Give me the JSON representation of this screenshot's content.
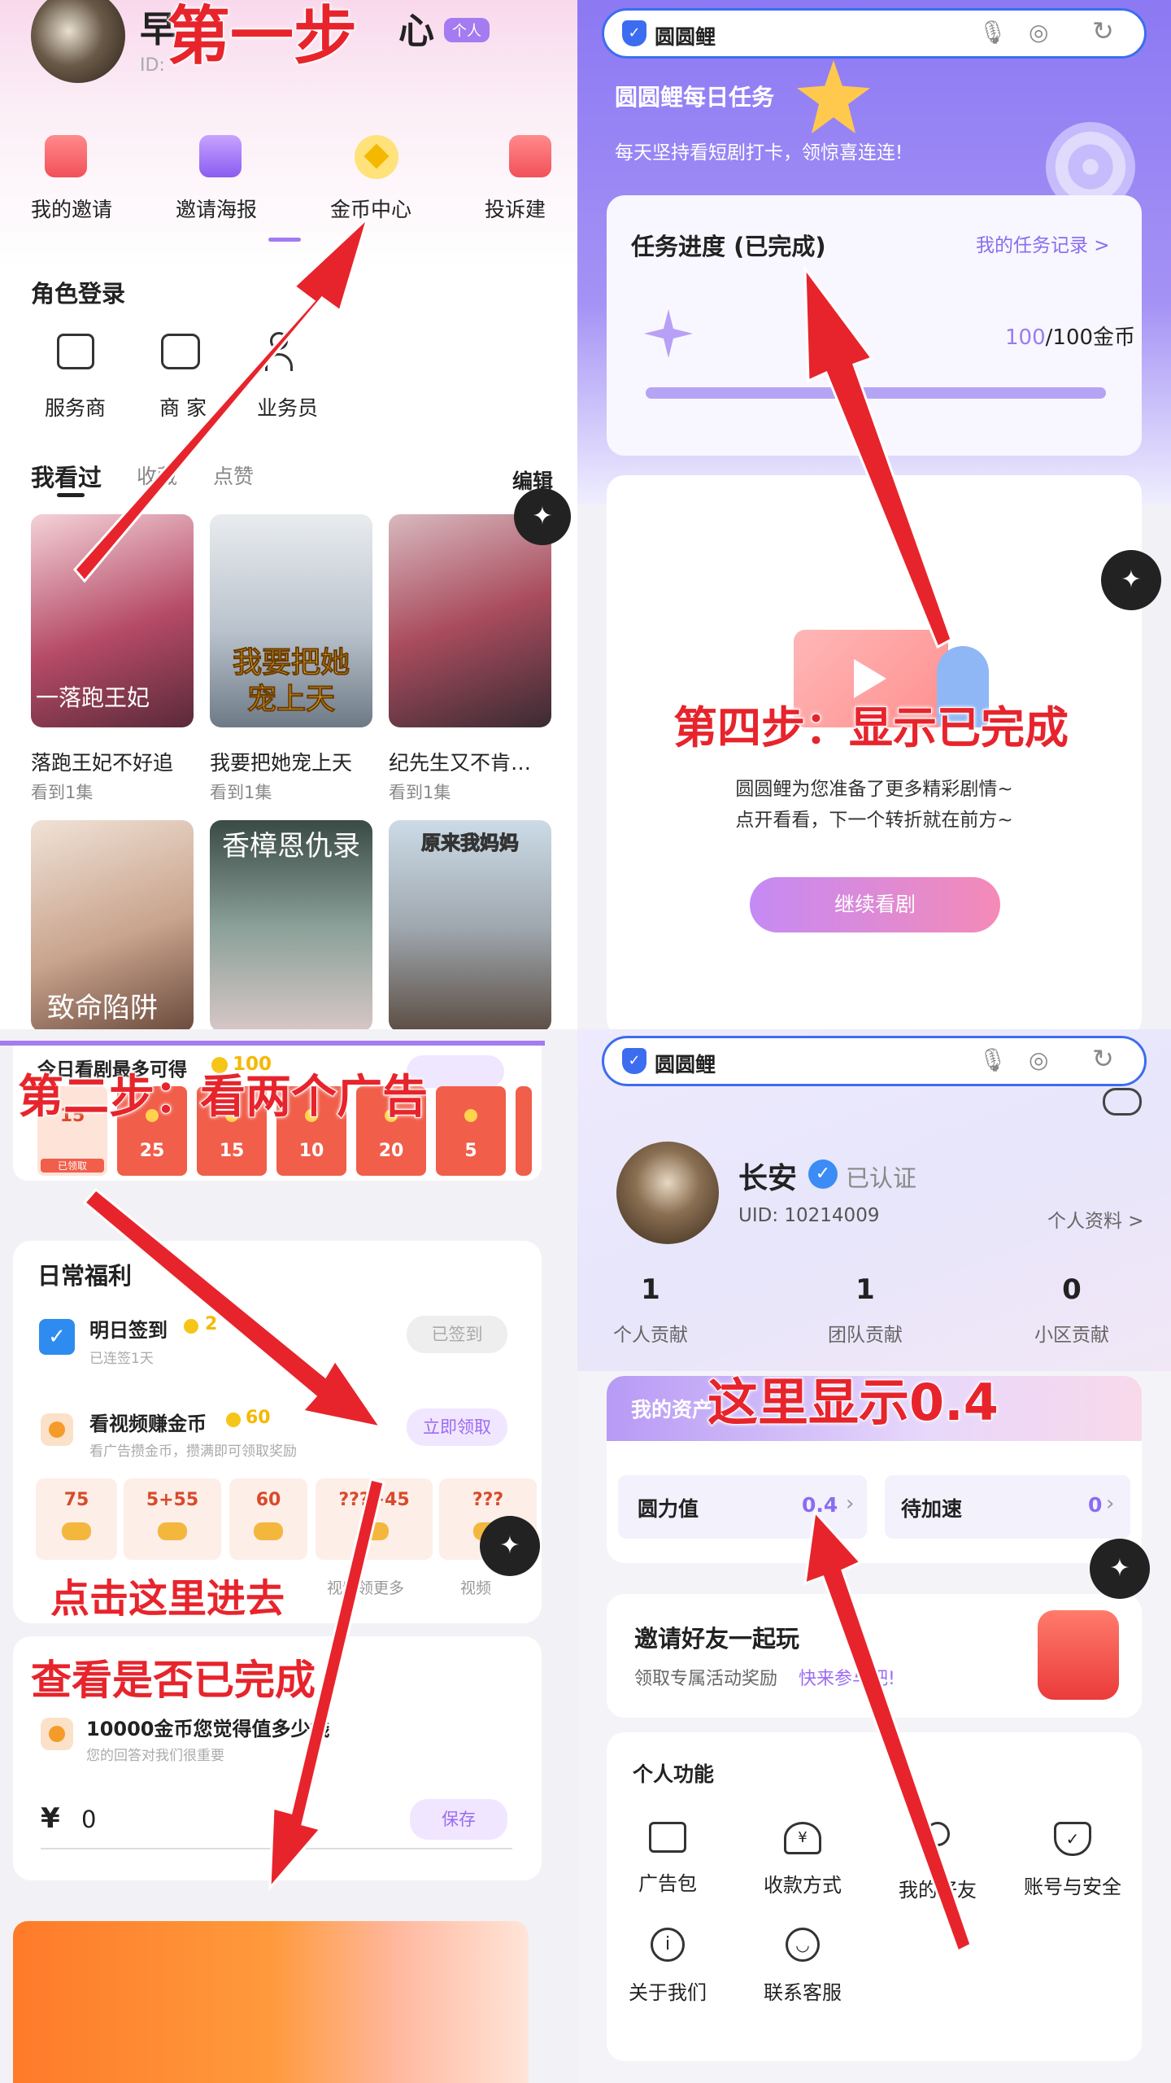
{
  "p1": {
    "header_title_partial": "早",
    "header_title_tail": "心",
    "id_prefix": "ID:",
    "badge": "个人",
    "nav": [
      "我的邀请",
      "邀请海报",
      "金币中心",
      "投诉建"
    ],
    "role_section_title": "角色登录",
    "roles": [
      "服务商",
      "商 家",
      "业务员"
    ],
    "history_tabs": [
      "我看过",
      "收藏",
      "点赞"
    ],
    "edit": "编辑",
    "posters": [
      {
        "title": "落跑王妃不好追",
        "sub": "看到1集",
        "art": "一落跑王妃"
      },
      {
        "title": "我要把她宠上天",
        "sub": "看到1集",
        "art": "我要把她宠上天"
      },
      {
        "title": "纪先生又不肯…",
        "sub": "看到1集",
        "art": ""
      }
    ],
    "posters2": [
      {
        "art": "致命陷阱"
      },
      {
        "art": "香樟恩仇录"
      },
      {
        "art": "原来我妈妈"
      }
    ],
    "annotation": "第一步"
  },
  "p2": {
    "app_name": "圆圆鲤",
    "banner_title": "圆圆鲤每日任务",
    "banner_sub": "每天坚持看短剧打卡，领惊喜连连!",
    "progress_title": "任务进度 (已完成)",
    "records_link": "我的任务记录 >",
    "progress_done": "100",
    "progress_total": "/100金币",
    "progress_fraction": 1.0,
    "empty_line1": "圆圆鲤为您准备了更多精彩剧情~",
    "empty_line2": "点开看看，下一个转折就在前方~",
    "continue_btn": "继续看剧",
    "annotation": "第四步：显示已完成"
  },
  "p3": {
    "today_label": "今日看剧最多可得",
    "today_coins": "100",
    "day_values": [
      "15",
      "25",
      "15",
      "10",
      "20",
      "5"
    ],
    "first_day_status": "已领取",
    "daily_title": "日常福利",
    "checkin_title": "明日签到",
    "checkin_coins": "2",
    "checkin_sub": "已连签1天",
    "checkin_btn": "已签到",
    "video_title": "看视频赚金币",
    "video_coins": "60",
    "video_sub": "看广告攒金币，攒满即可领取奖励",
    "video_btn": "立即领取",
    "tiles": [
      "75",
      "5+55",
      "60",
      "???+45",
      "???"
    ],
    "tile_captions": [
      "",
      "",
      "",
      "视频领更多",
      "视频"
    ],
    "survey_title": "10000金币您觉得值多少钱",
    "survey_sub": "您的回答对我们很重要",
    "currency": "¥",
    "answer_value": "0",
    "save_btn": "保存",
    "annotation_main": "第二步：看两个广告",
    "annotation_click": "点击这里进去",
    "annotation_check": "查看是否已完成"
  },
  "p4": {
    "app_name": "圆圆鲤",
    "user_name": "长安",
    "verified": "已认证",
    "uid": "UID: 10214009",
    "profile_link": "个人资料 >",
    "stats": [
      {
        "v": "1",
        "l": "个人贡献"
      },
      {
        "v": "1",
        "l": "团队贡献"
      },
      {
        "v": "0",
        "l": "小区贡献"
      }
    ],
    "assets_title": "我的资产",
    "asset1_label": "圆力值",
    "asset1_value": "0.4",
    "asset2_label": "待加速",
    "asset2_value": "0",
    "invite_title": "邀请好友一起玩",
    "invite_sub": "领取专属活动奖励",
    "invite_link": "快来参与吧!",
    "func_title": "个人功能",
    "funcs": [
      "广告包",
      "收款方式",
      "我的好友",
      "账号与安全",
      "关于我们",
      "联系客服"
    ],
    "annotation": "这里显示0.4"
  },
  "colors": {
    "accent_purple": "#9b6cf2",
    "coin": "#f5c518",
    "red": "#e7242c"
  }
}
